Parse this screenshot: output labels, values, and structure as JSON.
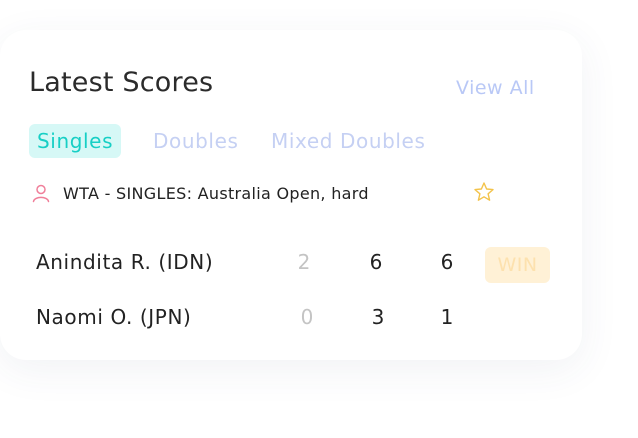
{
  "header": {
    "title": "Latest Scores",
    "view_all": "View All"
  },
  "tabs": [
    {
      "label": "Singles",
      "active": true
    },
    {
      "label": "Doubles",
      "active": false
    },
    {
      "label": "Mixed Doubles",
      "active": false
    }
  ],
  "match": {
    "tournament": "WTA - SINGLES: Australia Open, hard",
    "tournament_icon": "user-icon",
    "favorite_icon": "star-icon",
    "players": [
      {
        "name": "Anindita R. (IDN)",
        "sets": [
          "2",
          "6",
          "6"
        ],
        "result": "WIN"
      },
      {
        "name": "Naomi O. (JPN)",
        "sets": [
          "0",
          "3",
          "1"
        ]
      }
    ]
  },
  "colors": {
    "accent": "#17cfc5",
    "accent_bg": "#d6f8f6",
    "link": "#b9c8f6",
    "inactive_tab": "#c5d0f3",
    "win_bg": "#fff1d6",
    "win_text": "#fde1ae",
    "icon_pink": "#f07f9a",
    "star_yellow": "#f3c34a"
  }
}
